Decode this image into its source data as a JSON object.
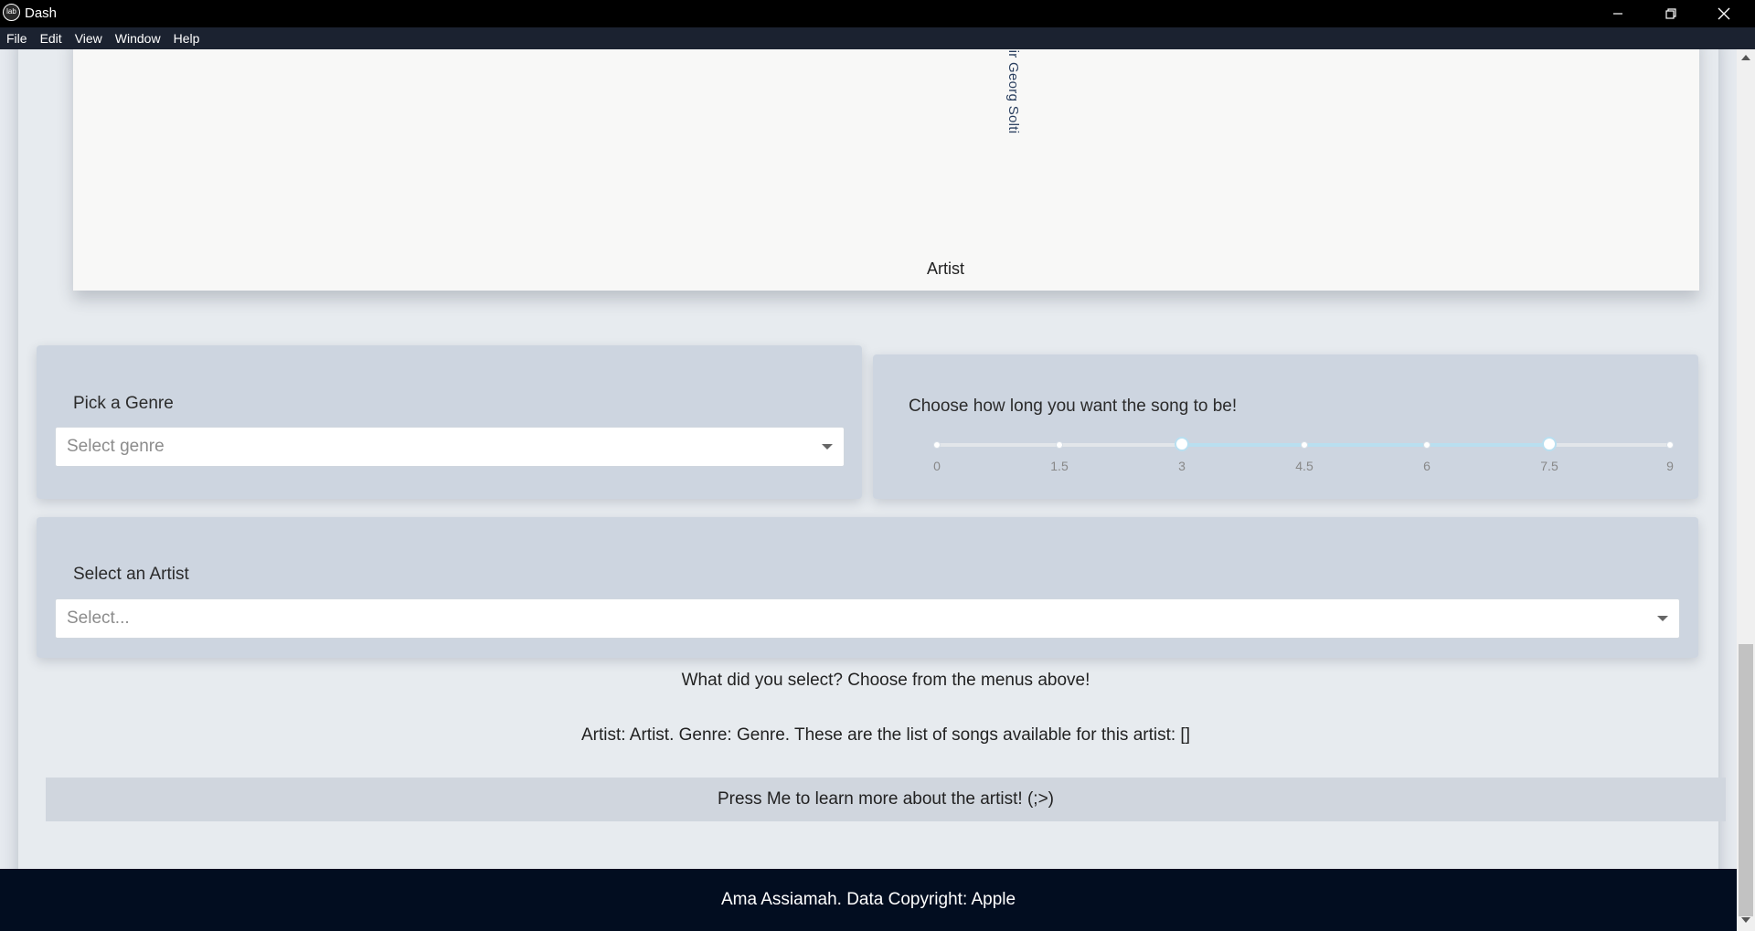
{
  "window": {
    "app_icon": "dash-lab-icon",
    "icon_text": "lab",
    "title": "Dash",
    "controls": [
      "minimize-icon",
      "restore-icon",
      "close-icon"
    ]
  },
  "menu": [
    "File",
    "Edit",
    "View",
    "Window",
    "Help"
  ],
  "chart_data": {
    "type": "bar",
    "tick_labels_visible": [
      "ony Orchestra & Sir Georg Solti"
    ],
    "xlabel": "Artist"
  },
  "genre_panel": {
    "label": "Pick a Genre",
    "placeholder": "Select genre"
  },
  "duration_panel": {
    "label": "Choose how long you want the song to be!",
    "min": 0,
    "max": 9,
    "selected_range": [
      3,
      7.5
    ],
    "marks": [
      "0",
      "1.5",
      "3",
      "4.5",
      "6",
      "7.5",
      "9"
    ]
  },
  "artist_panel": {
    "label": "Select an Artist",
    "placeholder": "Select..."
  },
  "output": {
    "question": "What did you select? Choose from the menus above!",
    "result": "Artist: Artist. Genre: Genre. These are the list of songs available for this artist: []",
    "button_label": "Press Me to learn more about the artist! (;>)"
  },
  "footer": {
    "text": "Ama Assiamah. Data Copyright: Apple"
  },
  "colors": {
    "title_bar": "#000000",
    "menu_bar": "#1b2230",
    "panel": "#cdd5e0",
    "slider_range": "#b9dff0",
    "footer": "#020d20"
  }
}
